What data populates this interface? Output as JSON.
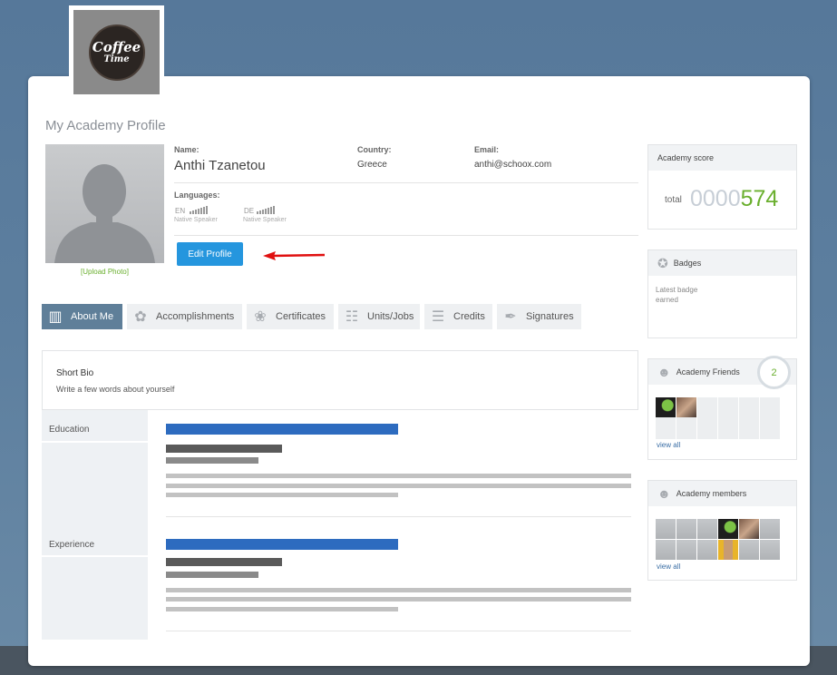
{
  "logo": {
    "line1": "Coffee",
    "line2": "Time"
  },
  "page_title": "My Academy Profile",
  "profile": {
    "upload_photo": "[Upload Photo]",
    "name_label": "Name:",
    "name": "Anthi Tzanetou",
    "country_label": "Country:",
    "country": "Greece",
    "email_label": "Email:",
    "email": "anthi@schoox.com",
    "languages_label": "Languages:",
    "languages": [
      {
        "code": "EN",
        "level": "Native Speaker"
      },
      {
        "code": "DE",
        "level": "Native Speaker"
      }
    ],
    "edit_button": "Edit Profile"
  },
  "tabs": [
    {
      "label": "About Me",
      "active": true,
      "icon": "person-card-icon"
    },
    {
      "label": "Accomplishments",
      "active": false,
      "icon": "laurel-icon"
    },
    {
      "label": "Certificates",
      "active": false,
      "icon": "certificate-icon"
    },
    {
      "label": "Units/Jobs",
      "active": false,
      "icon": "org-chart-icon"
    },
    {
      "label": "Credits",
      "active": false,
      "icon": "stack-icon"
    },
    {
      "label": "Signatures",
      "active": false,
      "icon": "signature-icon"
    }
  ],
  "bio": {
    "title": "Short Bio",
    "text": "Write a few words about yourself"
  },
  "sections": {
    "education": "Education",
    "experience": "Experience"
  },
  "score": {
    "title": "Academy score",
    "total_label": "total",
    "leading_zeros": "0000",
    "value": "574"
  },
  "badges": {
    "title": "Badges",
    "text": "Latest badge earned"
  },
  "friends": {
    "title": "Academy Friends",
    "count": "2",
    "view_all": "view all"
  },
  "members": {
    "title": "Academy members",
    "view_all": "view all"
  },
  "colors": {
    "accent_blue": "#2596de",
    "active_tab": "#5f7f99",
    "score_green": "#6aaf2e",
    "placeholder_bar_blue": "#2d6bbf",
    "arrow_red": "#e01010"
  }
}
